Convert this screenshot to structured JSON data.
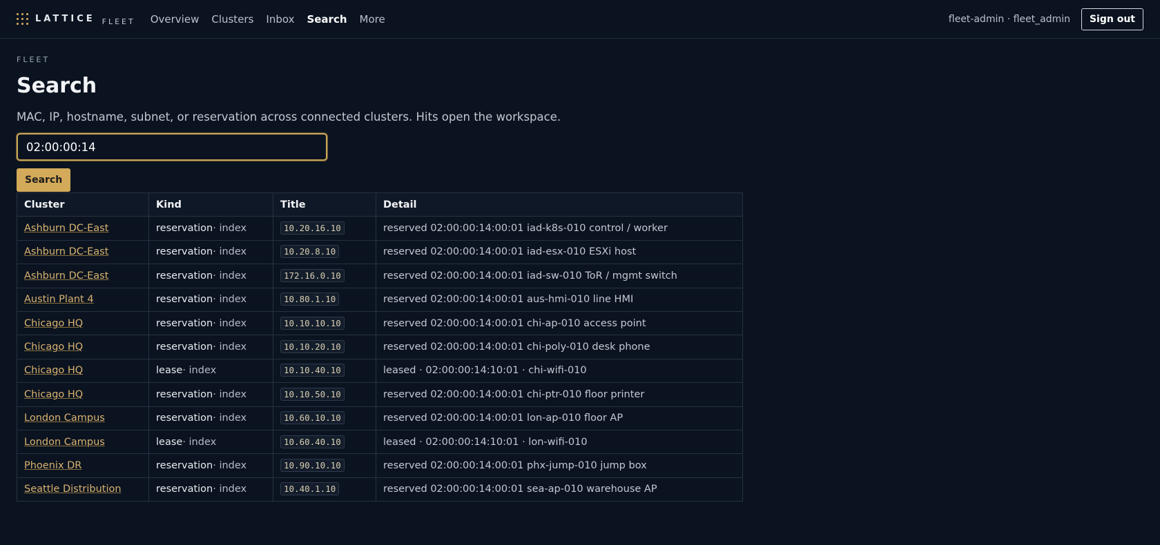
{
  "brand": {
    "name": "LATTICE",
    "sub": "FLEET"
  },
  "nav": [
    "Overview",
    "Clusters",
    "Inbox",
    "Search",
    "More"
  ],
  "nav_active": "Search",
  "user": {
    "label": "fleet-admin · fleet_admin",
    "signout": "Sign out"
  },
  "page": {
    "eyebrow": "FLEET",
    "title": "Search",
    "description": "MAC, IP, hostname, subnet, or reservation across connected clusters. Hits open the workspace."
  },
  "search": {
    "value": "02:00:00:14",
    "button": "Search"
  },
  "table": {
    "headers": [
      "Cluster",
      "Kind",
      "Title",
      "Detail"
    ],
    "rows": [
      {
        "cluster": "Ashburn DC-East",
        "kind": "reservation",
        "kind_sub": "· index",
        "title": "10.20.16.10",
        "detail": "reserved 02:00:00:14:00:01 iad-k8s-010 control / worker"
      },
      {
        "cluster": "Ashburn DC-East",
        "kind": "reservation",
        "kind_sub": "· index",
        "title": "10.20.8.10",
        "detail": "reserved 02:00:00:14:00:01 iad-esx-010 ESXi host"
      },
      {
        "cluster": "Ashburn DC-East",
        "kind": "reservation",
        "kind_sub": "· index",
        "title": "172.16.0.10",
        "detail": "reserved 02:00:00:14:00:01 iad-sw-010 ToR / mgmt switch"
      },
      {
        "cluster": "Austin Plant 4",
        "kind": "reservation",
        "kind_sub": "· index",
        "title": "10.80.1.10",
        "detail": "reserved 02:00:00:14:00:01 aus-hmi-010 line HMI"
      },
      {
        "cluster": "Chicago HQ",
        "kind": "reservation",
        "kind_sub": "· index",
        "title": "10.10.10.10",
        "detail": "reserved 02:00:00:14:00:01 chi-ap-010 access point"
      },
      {
        "cluster": "Chicago HQ",
        "kind": "reservation",
        "kind_sub": "· index",
        "title": "10.10.20.10",
        "detail": "reserved 02:00:00:14:00:01 chi-poly-010 desk phone"
      },
      {
        "cluster": "Chicago HQ",
        "kind": "lease",
        "kind_sub": "· index",
        "title": "10.10.40.10",
        "detail": "leased · 02:00:00:14:10:01 · chi-wifi-010"
      },
      {
        "cluster": "Chicago HQ",
        "kind": "reservation",
        "kind_sub": "· index",
        "title": "10.10.50.10",
        "detail": "reserved 02:00:00:14:00:01 chi-ptr-010 floor printer"
      },
      {
        "cluster": "London Campus",
        "kind": "reservation",
        "kind_sub": "· index",
        "title": "10.60.10.10",
        "detail": "reserved 02:00:00:14:00:01 lon-ap-010 floor AP"
      },
      {
        "cluster": "London Campus",
        "kind": "lease",
        "kind_sub": "· index",
        "title": "10.60.40.10",
        "detail": "leased · 02:00:00:14:10:01 · lon-wifi-010"
      },
      {
        "cluster": "Phoenix DR",
        "kind": "reservation",
        "kind_sub": "· index",
        "title": "10.90.10.10",
        "detail": "reserved 02:00:00:14:00:01 phx-jump-010 jump box"
      },
      {
        "cluster": "Seattle Distribution",
        "kind": "reservation",
        "kind_sub": "· index",
        "title": "10.40.1.10",
        "detail": "reserved 02:00:00:14:00:01 sea-ap-010 warehouse AP"
      }
    ]
  },
  "colors": {
    "background": "#0b1320",
    "accent": "#d3aa5a",
    "link": "#d9b370"
  }
}
